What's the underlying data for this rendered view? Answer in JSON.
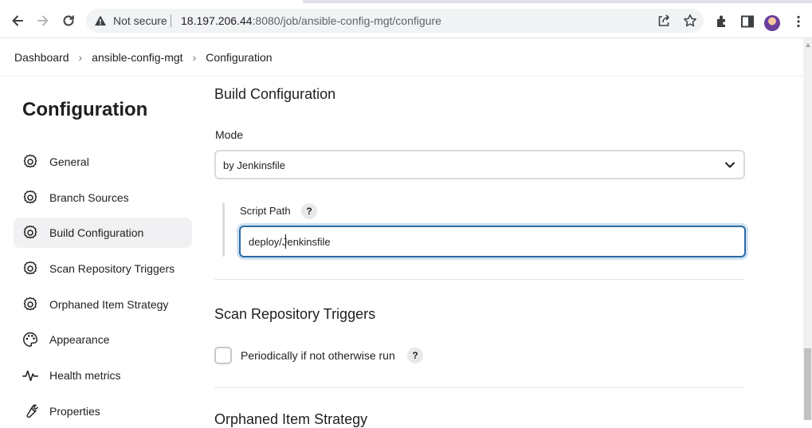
{
  "browser": {
    "security_label": "Not secure",
    "url_host": "18.197.206.44",
    "url_rest": ":8080/job/ansible-config-mgt/configure",
    "icons": [
      "back-icon",
      "forward-icon",
      "reload-icon",
      "warning-icon",
      "share-icon",
      "star-icon",
      "extensions-icon",
      "side-panel-icon",
      "profile-avatar",
      "menu-icon"
    ]
  },
  "breadcrumb": {
    "items": [
      "Dashboard",
      "ansible-config-mgt",
      "Configuration"
    ]
  },
  "sidebar": {
    "title": "Configuration",
    "items": [
      {
        "label": "General",
        "icon": "gear-icon",
        "active": false
      },
      {
        "label": "Branch Sources",
        "icon": "gear-icon",
        "active": false
      },
      {
        "label": "Build Configuration",
        "icon": "gear-icon",
        "active": true
      },
      {
        "label": "Scan Repository Triggers",
        "icon": "gear-icon",
        "active": false
      },
      {
        "label": "Orphaned Item Strategy",
        "icon": "gear-icon",
        "active": false
      },
      {
        "label": "Appearance",
        "icon": "palette-icon",
        "active": false
      },
      {
        "label": "Health metrics",
        "icon": "pulse-icon",
        "active": false
      },
      {
        "label": "Properties",
        "icon": "wrench-icon",
        "active": false
      }
    ]
  },
  "main": {
    "build_config": {
      "heading": "Build Configuration",
      "mode_label": "Mode",
      "mode_value": "by Jenkinsfile",
      "script_path_label": "Script Path",
      "script_path_value": "deploy/Jenkinsfile",
      "help_symbol": "?"
    },
    "scan_triggers": {
      "heading": "Scan Repository Triggers",
      "checkbox_label": "Periodically if not otherwise run",
      "checked": false,
      "help_symbol": "?"
    },
    "next_heading_partial": "Orphaned Item Strategy"
  },
  "colors": {
    "focus_border": "#2b6aa5",
    "active_item_bg": "#f1f1f3"
  }
}
